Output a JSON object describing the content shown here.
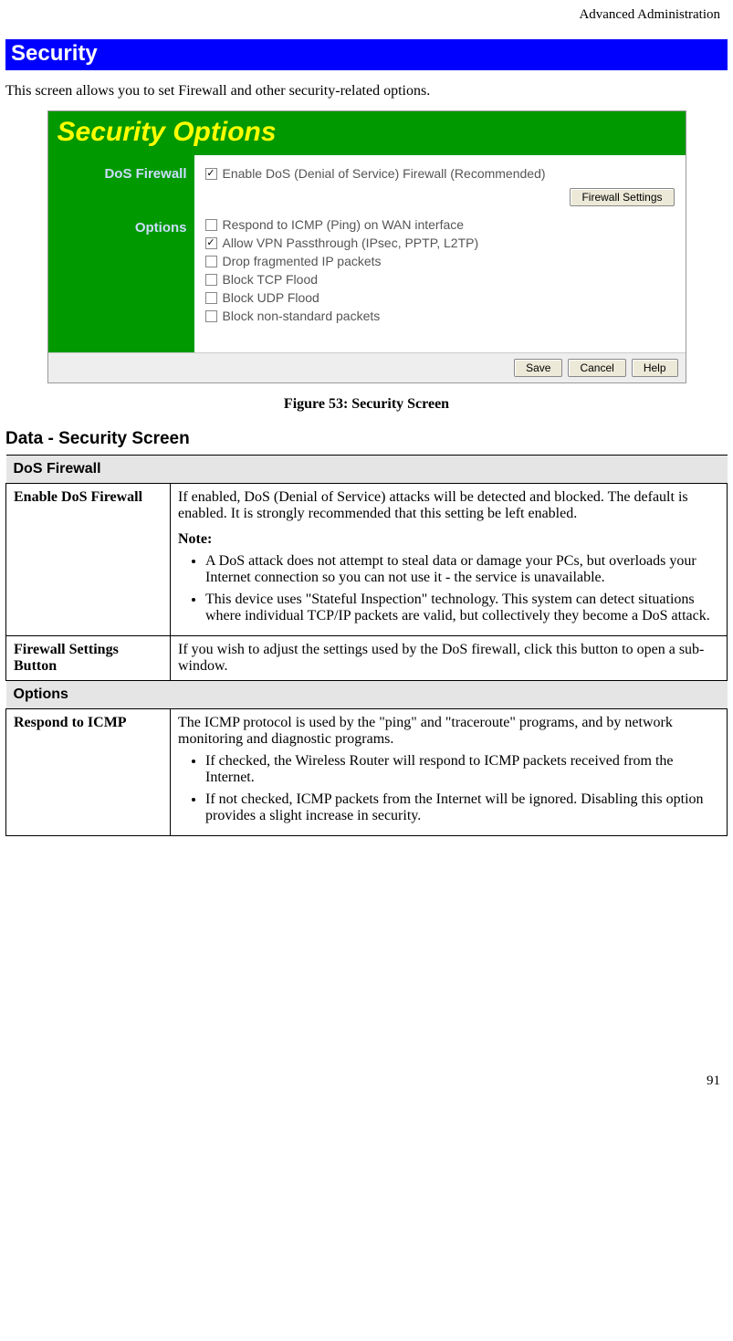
{
  "running_head": "Advanced Administration",
  "banner": "Security",
  "intro": "This screen allows you to set Firewall and other security-related options.",
  "figure": {
    "title": "Security Options",
    "side": {
      "dos": "DoS Firewall",
      "options": "Options"
    },
    "dos_checkbox": {
      "checked": true,
      "label": "Enable DoS (Denial of Service) Firewall (Recommended)"
    },
    "firewall_settings_btn": "Firewall Settings",
    "options_list": [
      {
        "checked": false,
        "label": "Respond to ICMP (Ping) on WAN interface"
      },
      {
        "checked": true,
        "label": "Allow VPN Passthrough (IPsec, PPTP, L2TP)"
      },
      {
        "checked": false,
        "label": "Drop fragmented IP packets"
      },
      {
        "checked": false,
        "label": "Block TCP Flood"
      },
      {
        "checked": false,
        "label": "Block UDP Flood"
      },
      {
        "checked": false,
        "label": "Block non-standard packets"
      }
    ],
    "footer_buttons": {
      "save": "Save",
      "cancel": "Cancel",
      "help": "Help"
    }
  },
  "caption": "Figure 53: Security Screen",
  "data_heading": "Data - Security Screen",
  "sections": {
    "dos_firewall": "DoS Firewall",
    "options": "Options"
  },
  "rows": {
    "enable_dos": {
      "label": "Enable DoS Firewall",
      "p1": "If enabled, DoS (Denial of Service) attacks will be detected and blocked. The default is enabled. It is strongly recommended that this setting be left enabled.",
      "note_label": "Note:",
      "b1": "A DoS attack does not attempt to steal data or damage your PCs, but overloads your Internet connection so you can not use it - the service is unavailable.",
      "b2": "This device uses \"Stateful Inspection\" technology. This system can detect situations where individual TCP/IP packets are valid, but collectively they become a DoS attack."
    },
    "fw_btn": {
      "label": "Firewall Settings Button",
      "p1": "If you wish to adjust the settings used by the DoS firewall, click this button to open a sub-window."
    },
    "respond_icmp": {
      "label": "Respond to ICMP",
      "p1": "The ICMP protocol is used by the \"ping\" and \"traceroute\" programs, and by network monitoring and diagnostic programs.",
      "b1": "If checked, the Wireless Router will respond to ICMP packets received from the Internet.",
      "b2": "If not checked, ICMP packets from the Internet will be ignored. Disabling this option provides a slight increase in security."
    }
  },
  "page_number": "91"
}
